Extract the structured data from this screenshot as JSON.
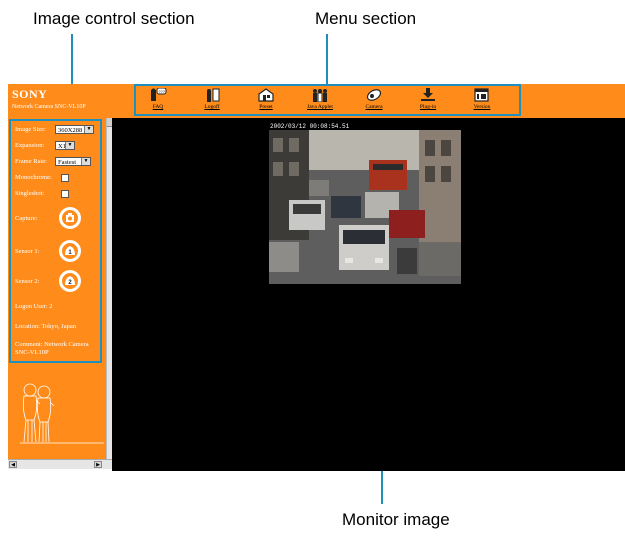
{
  "callouts": {
    "image_control": "Image control section",
    "menu": "Menu section",
    "monitor": "Monitor image"
  },
  "header": {
    "brand": "SONY",
    "model": "Network Camera SNC-VL10P"
  },
  "menu": {
    "items": [
      {
        "label": "FAQ",
        "icon": "faq-icon"
      },
      {
        "label": "Logoff",
        "icon": "logoff-icon"
      },
      {
        "label": "Preset",
        "icon": "preset-icon"
      },
      {
        "label": "Java Applet",
        "icon": "java-applet-icon"
      },
      {
        "label": "Camera",
        "icon": "camera-icon"
      },
      {
        "label": "Plug-in",
        "icon": "plugin-icon"
      },
      {
        "label": "Version",
        "icon": "version-icon"
      }
    ]
  },
  "controls": {
    "image_size_label": "Image Size:",
    "image_size_value": "360X288",
    "expansion_label": "Expansion:",
    "expansion_value": "X1",
    "frame_rate_label": "Frame Rate:",
    "frame_rate_value": "Fastest",
    "monochrome_label": "Monochrome:",
    "singleshot_label": "Singleshot:",
    "capture_label": "Capture:",
    "sensor1_label": "Sensor 1:",
    "sensor1_badge": "1",
    "sensor2_label": "Sensor 2:",
    "sensor2_badge": "2",
    "logon_user": "Logon User:  2",
    "location": "Location: Tokyo, Japan",
    "comment": "Comment: Network Camera SNC-VL10P"
  },
  "viewer": {
    "timestamp": "2002/03/12 00:08:54.51"
  },
  "colors": {
    "accent": "#ff8c1a",
    "callout_line": "#1f8fbd",
    "viewer_bg": "#000000"
  }
}
